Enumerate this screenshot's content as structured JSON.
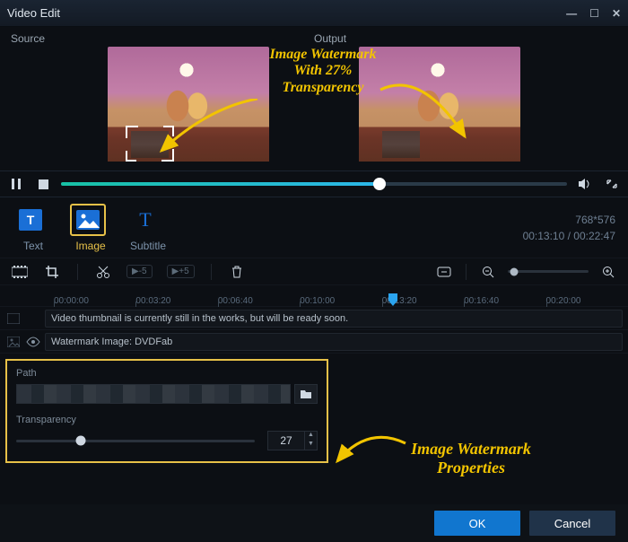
{
  "window": {
    "title": "Video Edit"
  },
  "preview": {
    "source_label": "Source",
    "output_label": "Output"
  },
  "annotations": {
    "top": "Image Watermark With 27% Transparency",
    "props": "Image Watermark Properties"
  },
  "playback": {
    "progress_pct": 63
  },
  "tabs": {
    "text": "Text",
    "image": "Image",
    "subtitle": "Subtitle",
    "selected": "image"
  },
  "media_info": {
    "resolution": "768*576",
    "time": "00:13:10 / 00:22:47"
  },
  "toolbar2": {
    "skip_back": "▶-5",
    "skip_fwd": "▶+5"
  },
  "timeline": {
    "ticks": [
      "00:00:00",
      "00:03:20",
      "00:06:40",
      "00:10:00",
      "00:13:20",
      "00:16:40",
      "00:20:00"
    ],
    "track_video_text": "Video thumbnail is currently still in the works, but will be ready soon.",
    "track_wm_text": "Watermark Image: DVDFab"
  },
  "props": {
    "path_label": "Path",
    "transparency_label": "Transparency",
    "transparency_value": "27"
  },
  "footer": {
    "ok": "OK",
    "cancel": "Cancel"
  }
}
